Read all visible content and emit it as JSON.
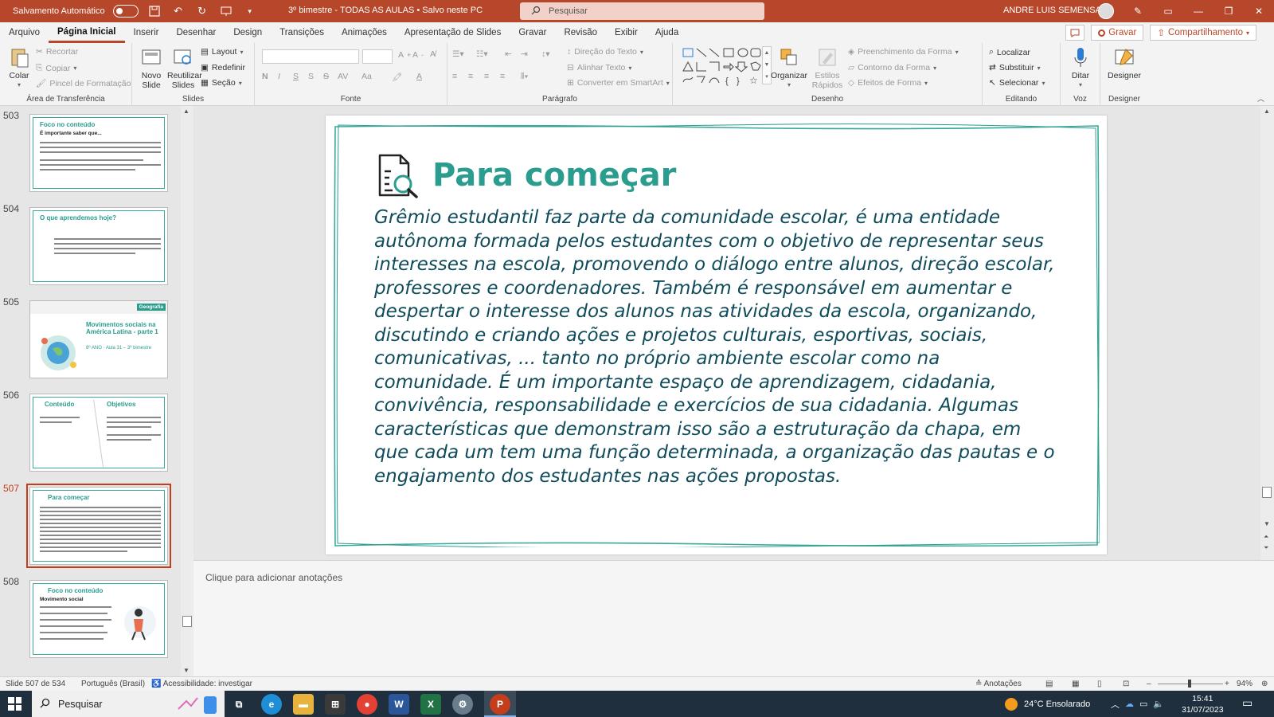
{
  "titlebar": {
    "autosave_label": "Salvamento Automático",
    "doc_title": "3º bimestre - TODAS AS AULAS • Salvo neste PC",
    "search_placeholder": "Pesquisar",
    "user_name": "ANDRE LUIS SEMENSATO"
  },
  "tabs": [
    "Arquivo",
    "Página Inicial",
    "Inserir",
    "Desenhar",
    "Design",
    "Transições",
    "Animações",
    "Apresentação de Slides",
    "Gravar",
    "Revisão",
    "Exibir",
    "Ajuda"
  ],
  "tabs_right": {
    "record": "Gravar",
    "share": "Compartilhamento"
  },
  "ribbon": {
    "clipboard": {
      "paste": "Colar",
      "cut": "Recortar",
      "copy": "Copiar",
      "format_painter": "Pincel de Formatação",
      "label": "Área de Transferência"
    },
    "slides": {
      "new_slide": "Novo Slide",
      "reuse": "Reutilizar Slides",
      "layout": "Layout",
      "reset": "Redefinir",
      "section": "Seção",
      "label": "Slides"
    },
    "font": {
      "label": "Fonte",
      "bold": "N",
      "italic": "I",
      "underline": "S",
      "strike": "S",
      "spacing": "AV",
      "case": "Aa"
    },
    "paragraph": {
      "label": "Parágrafo",
      "text_direction": "Direção do Texto",
      "align_text": "Alinhar Texto",
      "smartart": "Converter em SmartArt"
    },
    "drawing": {
      "label": "Desenho",
      "arrange": "Organizar",
      "quick_styles": "Estilos Rápidos",
      "fill": "Preenchimento da Forma",
      "outline": "Contorno da Forma",
      "effects": "Efeitos de Forma"
    },
    "editing": {
      "label": "Editando",
      "find": "Localizar",
      "replace": "Substituir",
      "select": "Selecionar"
    },
    "voice": {
      "label": "Voz",
      "dictate": "Ditar"
    },
    "designer": {
      "label": "Designer",
      "designer": "Designer"
    }
  },
  "thumbnails": [
    {
      "num": "503",
      "title": "Foco no conteúdo",
      "subtitle": "É importante saber que..."
    },
    {
      "num": "504",
      "title": "O que aprendemos hoje?",
      "subtitle": ""
    },
    {
      "num": "505",
      "title": "Movimentos sociais na América Latina - parte 1",
      "subtitle": "8º ANO · Aula 31 – 3º bimestre",
      "badge": "Geografia"
    },
    {
      "num": "506",
      "title": "Conteúdo",
      "subtitle": "Objetivos"
    },
    {
      "num": "507",
      "title": "Para começar",
      "subtitle": ""
    },
    {
      "num": "508",
      "title": "Foco no conteúdo",
      "subtitle": "Movimento social"
    }
  ],
  "slide": {
    "title": "Para começar",
    "body": "Grêmio estudantil faz parte da comunidade escolar, é uma entidade autônoma formada pelos estudantes com o objetivo de representar seus interesses na escola, promovendo o diálogo entre alunos, direção escolar, professores e coordenadores. Também é responsável em aumentar e despertar o interesse dos alunos nas atividades da escola, organizando, discutindo e criando ações e projetos culturais, esportivas, sociais, comunicativas, ... tanto no próprio ambiente escolar como na comunidade. É um importante espaço de aprendizagem, cidadania, convivência, responsabilidade e exercícios de sua cidadania. Algumas características que demonstram isso são a estruturação da chapa, em que cada um tem uma função determinada, a organização das pautas e o engajamento dos estudantes nas ações propostas."
  },
  "notes_placeholder": "Clique para adicionar anotações",
  "status": {
    "slide_info": "Slide 507 de 534",
    "language": "Português (Brasil)",
    "accessibility": "Acessibilidade: investigar",
    "notes": "Anotações",
    "zoom": "94%"
  },
  "taskbar": {
    "search": "Pesquisar",
    "weather": "24°C  Ensolarado",
    "time": "15:41",
    "date": "31/07/2023"
  },
  "colors": {
    "accent": "#b7472a",
    "teal": "#2a9d8f",
    "body_text": "#0f4b5a"
  }
}
